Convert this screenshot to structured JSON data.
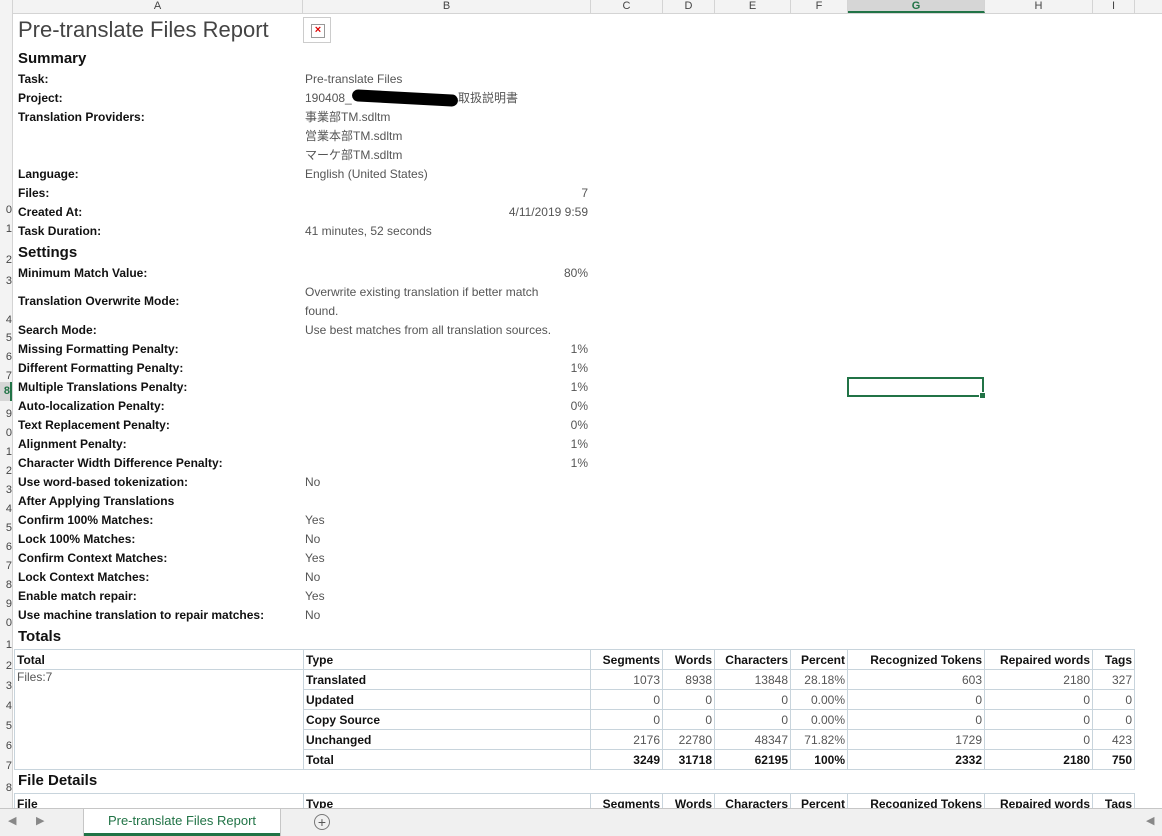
{
  "columns": [
    "A",
    "B",
    "C",
    "D",
    "E",
    "F",
    "G",
    "H",
    "I"
  ],
  "rows": [
    "",
    "",
    "",
    "",
    "",
    "",
    "",
    "",
    "",
    "0",
    "1",
    "2",
    "3",
    "",
    "4",
    "5",
    "6",
    "7",
    "8",
    "9",
    "0",
    "1",
    "2",
    "3",
    "4",
    "5",
    "6",
    "7",
    "8",
    "9",
    "0",
    "1",
    "2",
    "3",
    "4",
    "5",
    "6",
    "7",
    "8"
  ],
  "report_title": "Pre-translate Files Report",
  "summary": {
    "heading": "Summary",
    "task_label": "Task:",
    "task": "Pre-translate Files",
    "project_label": "Project:",
    "project": "190408_",
    "project_suffix": "取扱説明書",
    "providers_label": "Translation Providers:",
    "providers": [
      "事業部TM.sdltm",
      "営業本部TM.sdltm",
      "マーケ部TM.sdltm"
    ],
    "language_label": "Language:",
    "language": "English (United States)",
    "files_label": "Files:",
    "files": "7",
    "created_label": "Created At:",
    "created": "4/11/2019 9:59",
    "duration_label": "Task Duration:",
    "duration": "41 minutes, 52 seconds"
  },
  "settings": {
    "heading": "Settings",
    "min_match_label": "Minimum Match Value:",
    "min_match": "80%",
    "overwrite_label": "Translation Overwrite Mode:",
    "overwrite_1": "Overwrite existing translation if better match",
    "overwrite_2": "found.",
    "search_label": "Search Mode:",
    "search": "Use best matches from all translation sources.",
    "missing_fmt_label": "Missing Formatting Penalty:",
    "missing_fmt": "1%",
    "diff_fmt_label": "Different Formatting Penalty:",
    "diff_fmt": "1%",
    "multi_label": "Multiple Translations Penalty:",
    "multi": "1%",
    "autoloc_label": "Auto-localization Penalty:",
    "autoloc": "0%",
    "textrepl_label": "Text Replacement Penalty:",
    "textrepl": "0%",
    "align_label": "Alignment Penalty:",
    "align": "1%",
    "charwidth_label": "Character Width Difference Penalty:",
    "charwidth": "1%",
    "wordtok_label": "Use word-based tokenization:",
    "wordtok": "No",
    "after_label": "After Applying Translations",
    "confirm100_label": "Confirm 100% Matches:",
    "confirm100": "Yes",
    "lock100_label": "Lock 100% Matches:",
    "lock100": "No",
    "confirmctx_label": "Confirm Context Matches:",
    "confirmctx": "Yes",
    "lockctx_label": "Lock Context Matches:",
    "lockctx": "No",
    "repair_label": "Enable match repair:",
    "repair": "Yes",
    "mtrepair_label": "Use machine translation to repair matches:",
    "mtrepair": "No"
  },
  "totals": {
    "heading": "Totals",
    "headers": [
      "Total",
      "Type",
      "Segments",
      "Words",
      "Characters",
      "Percent",
      "Recognized Tokens",
      "Repaired words",
      "Tags"
    ],
    "files_cell": "Files:7",
    "rows": [
      [
        "Translated",
        "1073",
        "8938",
        "13848",
        "28.18%",
        "603",
        "2180",
        "327"
      ],
      [
        "Updated",
        "0",
        "0",
        "0",
        "0.00%",
        "0",
        "0",
        "0"
      ],
      [
        "Copy Source",
        "0",
        "0",
        "0",
        "0.00%",
        "0",
        "0",
        "0"
      ],
      [
        "Unchanged",
        "2176",
        "22780",
        "48347",
        "71.82%",
        "1729",
        "0",
        "423"
      ],
      [
        "Total",
        "3249",
        "31718",
        "62195",
        "100%",
        "2332",
        "2180",
        "750"
      ]
    ]
  },
  "file_details": {
    "heading": "File Details",
    "headers": [
      "File",
      "Type",
      "Segments",
      "Words",
      "Characters",
      "Percent",
      "Recognized Tokens",
      "Repaired words",
      "Tags"
    ]
  },
  "sheet_tab": "Pre-translate Files Report",
  "add_sheet": "+",
  "nav_prev": "◀",
  "nav_next": "▶"
}
